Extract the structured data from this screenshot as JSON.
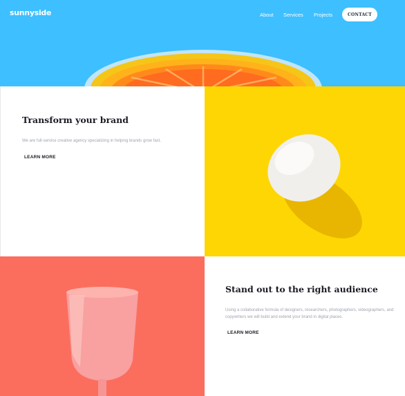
{
  "header": {
    "logo": "sunnyside",
    "nav": {
      "about": "About",
      "services": "Services",
      "projects": "Projects",
      "contact": "CONTACT"
    }
  },
  "section_transform": {
    "heading": "Transform your brand",
    "body": "We are full-service creative agency specializing in helping brands grow fast.",
    "link": "LEARN MORE"
  },
  "section_audience": {
    "heading": "Stand out to the right audience",
    "body": "Using a collaborative formula of designers, researchers, photographers, videographers, and copywriters we will build and extend your brand in digital places.",
    "link": "LEARN MORE"
  },
  "colors": {
    "hero_blue": "#3ebfff",
    "yellow": "#fed603",
    "coral": "#fb6e5e",
    "heading": "#1a1a23",
    "body_text": "#9da3b0"
  },
  "icons": {
    "hero_image": "orange-slice-image",
    "egg_image": "egg-image",
    "glass_image": "pink-cup-image"
  }
}
